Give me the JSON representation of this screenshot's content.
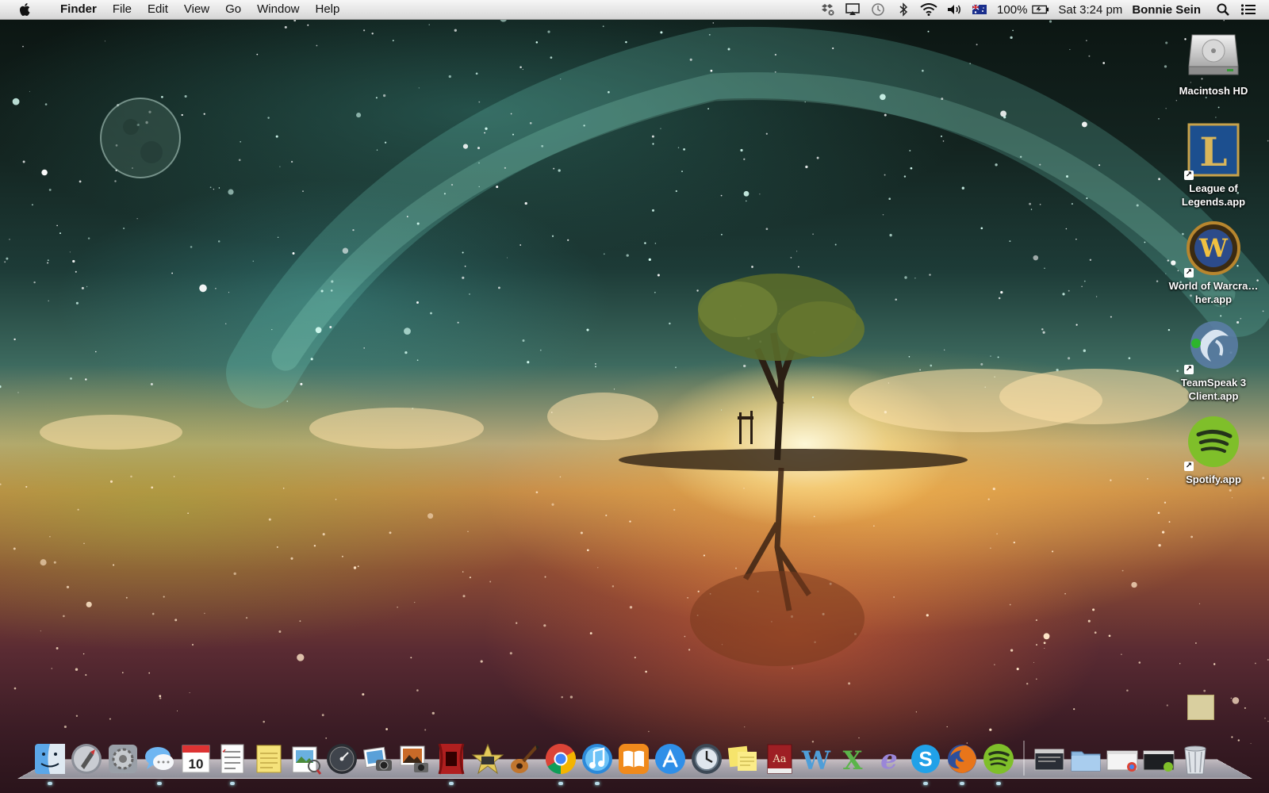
{
  "menubar": {
    "app_name": "Finder",
    "menus": [
      "File",
      "Edit",
      "View",
      "Go",
      "Window",
      "Help"
    ],
    "status": {
      "battery_percent": "100%",
      "clock": "Sat 3:24 pm",
      "user": "Bonnie Sein"
    }
  },
  "desktop": {
    "icons": [
      {
        "label": "Macintosh HD"
      },
      {
        "label": "League of Legends.app"
      },
      {
        "label": "World of Warcra…her.app"
      },
      {
        "label": "TeamSpeak 3 Client.app"
      },
      {
        "label": "Spotify.app"
      }
    ]
  },
  "dock": {
    "apps": [
      "finder-icon",
      "launchpad-icon",
      "system-preferences-icon",
      "messages-icon",
      "calendar-icon",
      "reminders-icon",
      "notes-icon",
      "preview-icon",
      "dashboard-icon",
      "iphoto-icon",
      "image-capture-icon",
      "photo-booth-icon",
      "imovie-icon",
      "garageband-icon",
      "chrome-icon",
      "itunes-icon",
      "ibooks-icon",
      "app-store-icon",
      "time-machine-icon",
      "stickies-icon",
      "dictionary-icon",
      "word-icon",
      "excel-icon",
      "entourage-icon",
      "skype-icon",
      "firefox-icon",
      "spotify-icon"
    ],
    "calendar_day": "10",
    "dictionary_glyph": "Aa",
    "word_glyph": "W",
    "excel_glyph": "X",
    "entourage_glyph": "e",
    "skype_glyph": "S"
  }
}
